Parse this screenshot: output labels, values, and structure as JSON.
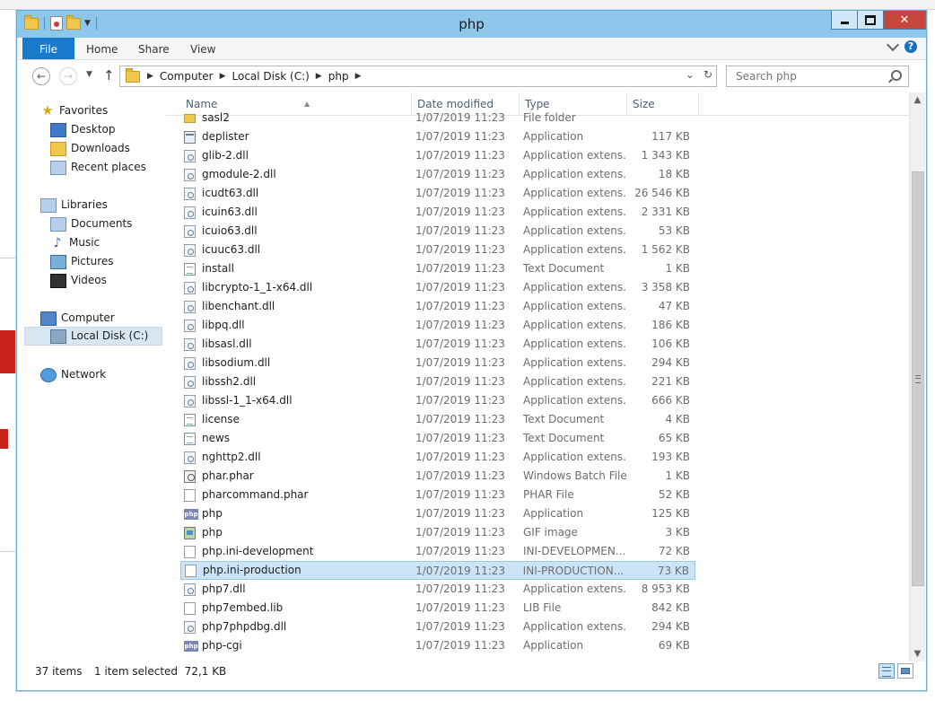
{
  "window": {
    "title": "php"
  },
  "ribbon": {
    "tabs": [
      "File",
      "Home",
      "Share",
      "View"
    ]
  },
  "address": {
    "crumbs": [
      "Computer",
      "Local Disk (C:)",
      "php"
    ]
  },
  "search": {
    "placeholder": "Search php"
  },
  "nav": {
    "favorites": {
      "label": "Favorites",
      "items": [
        "Desktop",
        "Downloads",
        "Recent places"
      ]
    },
    "libraries": {
      "label": "Libraries",
      "items": [
        "Documents",
        "Music",
        "Pictures",
        "Videos"
      ]
    },
    "computer": {
      "label": "Computer",
      "items": [
        "Local Disk (C:)"
      ]
    },
    "network": {
      "label": "Network"
    }
  },
  "columns": {
    "name": "Name",
    "date": "Date modified",
    "type": "Type",
    "size": "Size"
  },
  "files": [
    {
      "name": "sasl2",
      "date": "1/07/2019 11:23",
      "type": "File folder",
      "size": "",
      "icon": "folder"
    },
    {
      "name": "deplister",
      "date": "1/07/2019 11:23",
      "type": "Application",
      "size": "117 KB",
      "icon": "exe"
    },
    {
      "name": "glib-2.dll",
      "date": "1/07/2019 11:23",
      "type": "Application extens...",
      "size": "1 343 KB",
      "icon": "dll"
    },
    {
      "name": "gmodule-2.dll",
      "date": "1/07/2019 11:23",
      "type": "Application extens...",
      "size": "18 KB",
      "icon": "dll"
    },
    {
      "name": "icudt63.dll",
      "date": "1/07/2019 11:23",
      "type": "Application extens...",
      "size": "26 546 KB",
      "icon": "dll"
    },
    {
      "name": "icuin63.dll",
      "date": "1/07/2019 11:23",
      "type": "Application extens...",
      "size": "2 331 KB",
      "icon": "dll"
    },
    {
      "name": "icuio63.dll",
      "date": "1/07/2019 11:23",
      "type": "Application extens...",
      "size": "53 KB",
      "icon": "dll"
    },
    {
      "name": "icuuc63.dll",
      "date": "1/07/2019 11:23",
      "type": "Application extens...",
      "size": "1 562 KB",
      "icon": "dll"
    },
    {
      "name": "install",
      "date": "1/07/2019 11:23",
      "type": "Text Document",
      "size": "1 KB",
      "icon": "txt"
    },
    {
      "name": "libcrypto-1_1-x64.dll",
      "date": "1/07/2019 11:23",
      "type": "Application extens...",
      "size": "3 358 KB",
      "icon": "dll"
    },
    {
      "name": "libenchant.dll",
      "date": "1/07/2019 11:23",
      "type": "Application extens...",
      "size": "47 KB",
      "icon": "dll"
    },
    {
      "name": "libpq.dll",
      "date": "1/07/2019 11:23",
      "type": "Application extens...",
      "size": "186 KB",
      "icon": "dll"
    },
    {
      "name": "libsasl.dll",
      "date": "1/07/2019 11:23",
      "type": "Application extens...",
      "size": "106 KB",
      "icon": "dll"
    },
    {
      "name": "libsodium.dll",
      "date": "1/07/2019 11:23",
      "type": "Application extens...",
      "size": "294 KB",
      "icon": "dll"
    },
    {
      "name": "libssh2.dll",
      "date": "1/07/2019 11:23",
      "type": "Application extens...",
      "size": "221 KB",
      "icon": "dll"
    },
    {
      "name": "libssl-1_1-x64.dll",
      "date": "1/07/2019 11:23",
      "type": "Application extens...",
      "size": "666 KB",
      "icon": "dll"
    },
    {
      "name": "license",
      "date": "1/07/2019 11:23",
      "type": "Text Document",
      "size": "4 KB",
      "icon": "txt"
    },
    {
      "name": "news",
      "date": "1/07/2019 11:23",
      "type": "Text Document",
      "size": "65 KB",
      "icon": "txt"
    },
    {
      "name": "nghttp2.dll",
      "date": "1/07/2019 11:23",
      "type": "Application extens...",
      "size": "193 KB",
      "icon": "dll"
    },
    {
      "name": "phar.phar",
      "date": "1/07/2019 11:23",
      "type": "Windows Batch File",
      "size": "1 KB",
      "icon": "bat"
    },
    {
      "name": "pharcommand.phar",
      "date": "1/07/2019 11:23",
      "type": "PHAR File",
      "size": "52 KB",
      "icon": "blank"
    },
    {
      "name": "php",
      "date": "1/07/2019 11:23",
      "type": "Application",
      "size": "125 KB",
      "icon": "php"
    },
    {
      "name": "php",
      "date": "1/07/2019 11:23",
      "type": "GIF image",
      "size": "3 KB",
      "icon": "gif"
    },
    {
      "name": "php.ini-development",
      "date": "1/07/2019 11:23",
      "type": "INI-DEVELOPMEN...",
      "size": "72 KB",
      "icon": "blank"
    },
    {
      "name": "php.ini-production",
      "date": "1/07/2019 11:23",
      "type": "INI-PRODUCTION...",
      "size": "73 KB",
      "icon": "blank",
      "selected": true
    },
    {
      "name": "php7.dll",
      "date": "1/07/2019 11:23",
      "type": "Application extens...",
      "size": "8 953 KB",
      "icon": "dll"
    },
    {
      "name": "php7embed.lib",
      "date": "1/07/2019 11:23",
      "type": "LIB File",
      "size": "842 KB",
      "icon": "blank"
    },
    {
      "name": "php7phpdbg.dll",
      "date": "1/07/2019 11:23",
      "type": "Application extens...",
      "size": "294 KB",
      "icon": "dll"
    },
    {
      "name": "php-cgi",
      "date": "1/07/2019 11:23",
      "type": "Application",
      "size": "69 KB",
      "icon": "php"
    }
  ],
  "status": {
    "count": "37 items",
    "selection": "1 item selected  72,1 KB"
  },
  "colors": {
    "accent": "#1979ca",
    "titlebar": "#8dc8ec",
    "selection": "#cce4f7",
    "close": "#c7463b"
  }
}
